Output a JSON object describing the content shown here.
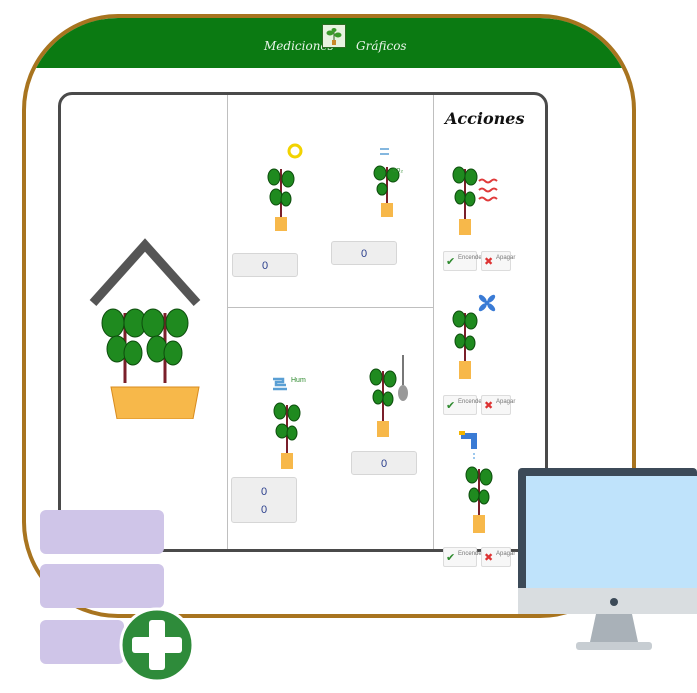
{
  "nav": {
    "left_label": "Mediciones",
    "right_label": "Gráficos",
    "logo_icon": "plant-logo-icon"
  },
  "colors": {
    "bar_green": "#0b7a12",
    "frame_brown": "#a8741f",
    "button_lavender": "#cfc5e8",
    "plus_green": "#2e8b3a",
    "screen_blue": "#bfe3fb"
  },
  "measurements": {
    "light_value": "0",
    "co2_value": "0",
    "co2_label": "co₂",
    "humidity_label": "Hum",
    "humidity_values": [
      "0",
      "0"
    ],
    "soil_value": "0"
  },
  "actions": {
    "title": "Acciones",
    "items": [
      {
        "name": "heater",
        "icon": "heat-waves-icon",
        "ok_label": "Encender",
        "no_label": "Apagar"
      },
      {
        "name": "fan",
        "icon": "fan-icon",
        "ok_label": "Encender",
        "no_label": "Apagar"
      },
      {
        "name": "water",
        "icon": "faucet-icon",
        "ok_label": "Encender",
        "no_label": "Apagar"
      }
    ]
  }
}
